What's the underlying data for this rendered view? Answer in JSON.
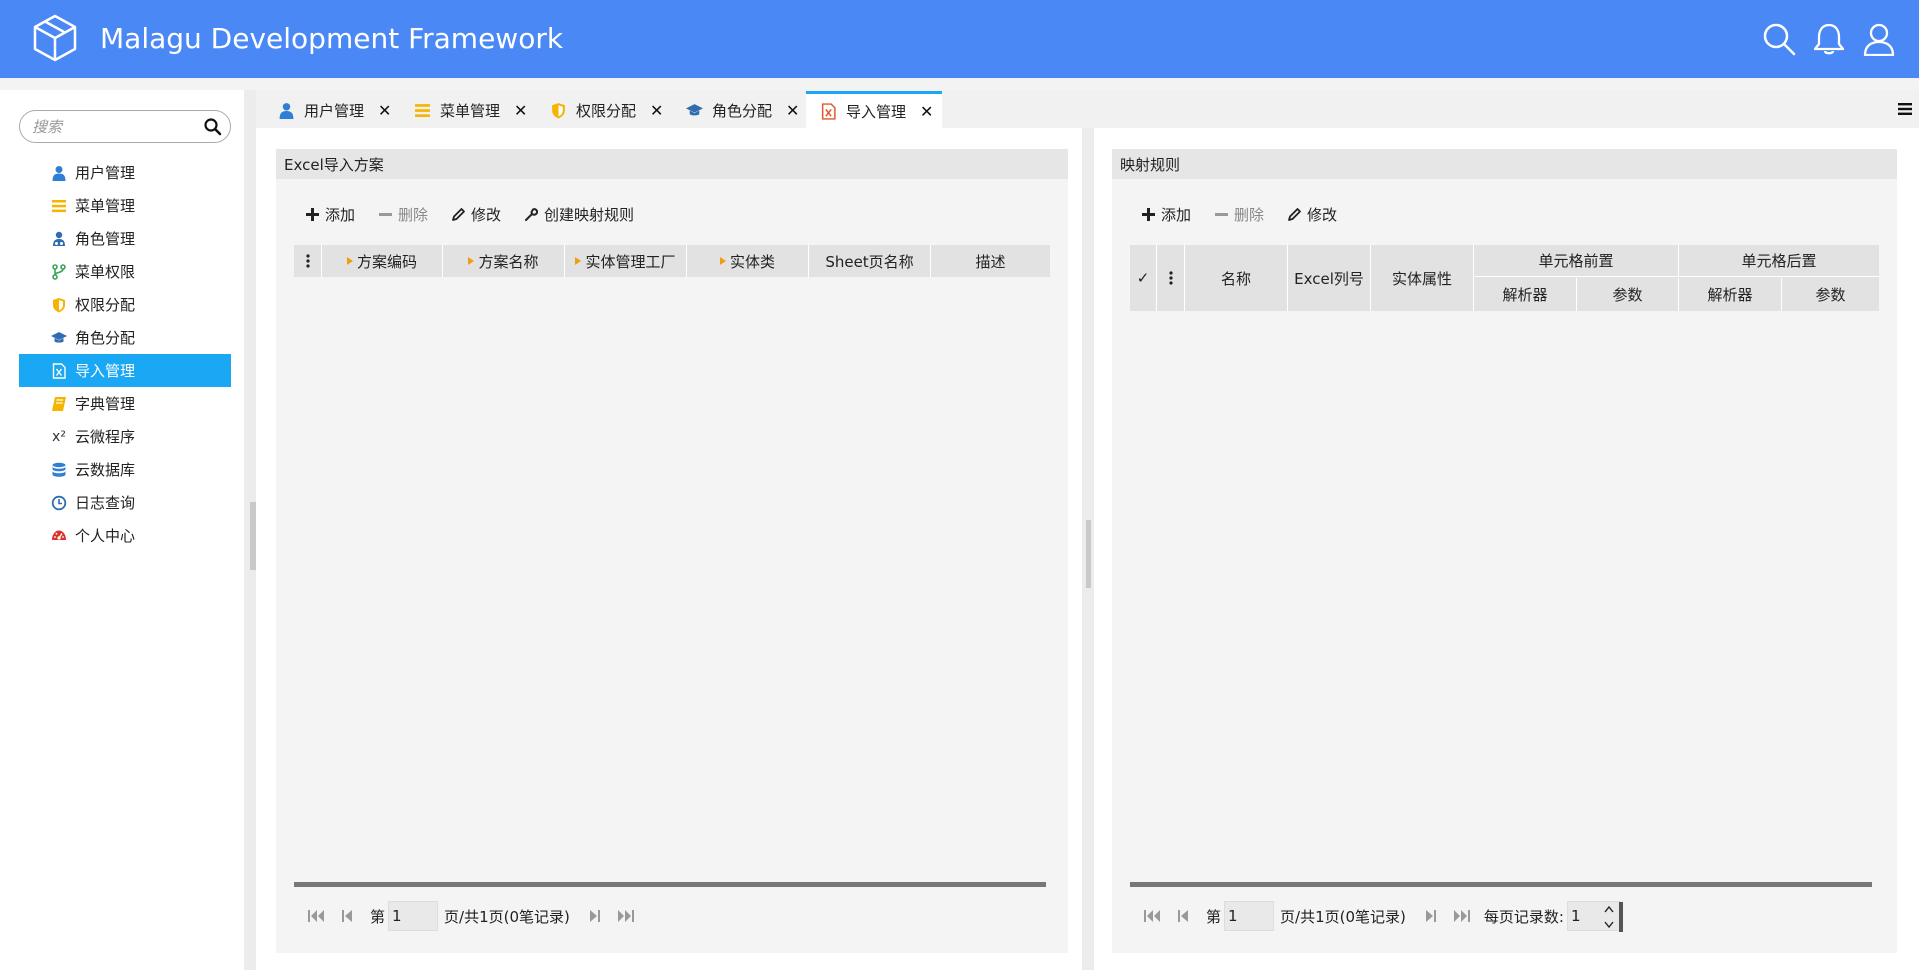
{
  "header": {
    "title": "Malagu Development Framework",
    "icons": [
      "cube-logo-icon",
      "search-icon",
      "bell-icon",
      "user-icon"
    ],
    "color": "#4a88f5"
  },
  "sidebar": {
    "search_placeholder": "搜索",
    "active_color": "#1aa8f5",
    "items": [
      {
        "label": "用户管理",
        "icon": "user-icon"
      },
      {
        "label": "菜单管理",
        "icon": "menu-lines-icon"
      },
      {
        "label": "角色管理",
        "icon": "users-role-icon"
      },
      {
        "label": "菜单权限",
        "icon": "branch-icon"
      },
      {
        "label": "权限分配",
        "icon": "shield-icon"
      },
      {
        "label": "角色分配",
        "icon": "graduation-cap-icon"
      },
      {
        "label": "导入管理",
        "icon": "excel-file-icon",
        "active": true
      },
      {
        "label": "字典管理",
        "icon": "book-icon"
      },
      {
        "label": "云微程序",
        "icon": "superscript-icon",
        "glyph": "x²"
      },
      {
        "label": "云数据库",
        "icon": "database-icon"
      },
      {
        "label": "日志查询",
        "icon": "clock-icon"
      },
      {
        "label": "个人中心",
        "icon": "dashboard-icon"
      }
    ]
  },
  "tabs": [
    {
      "label": "用户管理",
      "icon": "user-icon"
    },
    {
      "label": "菜单管理",
      "icon": "menu-lines-icon"
    },
    {
      "label": "权限分配",
      "icon": "shield-icon"
    },
    {
      "label": "角色分配",
      "icon": "graduation-cap-icon"
    },
    {
      "label": "导入管理",
      "icon": "excel-file-icon",
      "active": true
    }
  ],
  "left_panel": {
    "title": "Excel导入方案",
    "toolbar": {
      "add": "添加",
      "delete": "删除",
      "edit": "修改",
      "create_rule": "创建映射规则"
    },
    "columns": [
      "方案编码",
      "方案名称",
      "实体管理工厂",
      "实体类",
      "Sheet页名称",
      "描述"
    ],
    "pager": {
      "page_prefix": "第",
      "page_value": "1",
      "page_suffix": "页/共1页(0笔记录)"
    }
  },
  "right_panel": {
    "title": "映射规则",
    "toolbar": {
      "add": "添加",
      "delete": "删除",
      "edit": "修改"
    },
    "columns": {
      "check": "✓",
      "name": "名称",
      "excel_col": "Excel列号",
      "entity_attr": "实体属性",
      "pre_group": "单元格前置",
      "post_group": "单元格后置",
      "parser": "解析器",
      "param": "参数"
    },
    "pager": {
      "page_prefix": "第",
      "page_value": "1",
      "page_suffix": "页/共1页(0笔记录)",
      "per_page_label": "每页记录数:",
      "per_page_value": "1"
    }
  }
}
